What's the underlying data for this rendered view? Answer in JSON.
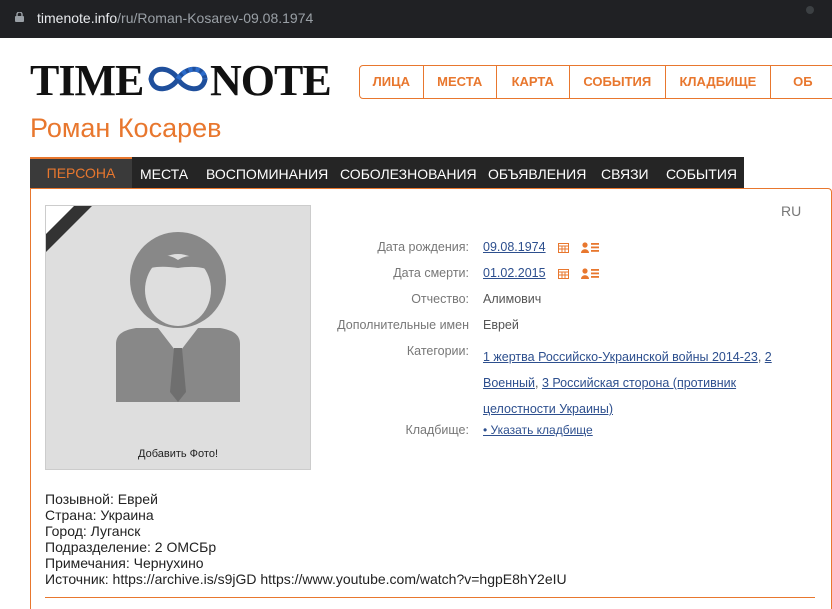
{
  "browser": {
    "url_host": "timenote.info",
    "url_path": "/ru/Roman-Kosarev-09.08.1974"
  },
  "logo": {
    "word1": "TIME",
    "word2": "NOTE"
  },
  "top_nav": [
    {
      "label": "ЛИЦА"
    },
    {
      "label": "МЕСТА"
    },
    {
      "label": "КАРТА"
    },
    {
      "label": "СОБЫТИЯ"
    },
    {
      "label": "КЛАДБИЩЕ"
    },
    {
      "label": "ОБ"
    }
  ],
  "person": {
    "name": "Роман Косарев"
  },
  "tabs": [
    {
      "label": "ПЕРСОНА"
    },
    {
      "label": "МЕСТА"
    },
    {
      "label": "ВОСПОМИНАНИЯ"
    },
    {
      "label": "СОБОЛЕЗНОВАНИЯ"
    },
    {
      "label": "ОБЪЯВЛЕНИЯ"
    },
    {
      "label": "СВЯЗИ"
    },
    {
      "label": "СОБЫТИЯ"
    }
  ],
  "lang": "RU",
  "photo": {
    "add_label": "Добавить Фото!"
  },
  "details": {
    "birth_label": "Дата рождения:",
    "birth_value": "09.08.1974",
    "death_label": "Дата смерти:",
    "death_value": "01.02.2015",
    "patronymic_label": "Отчество:",
    "patronymic_value": "Алимович",
    "extra_names_label": "Дополнительные имен",
    "extra_names_value": "Еврей",
    "categories_label": "Категории:",
    "categories": [
      {
        "label": "1 жертва Российско-Украинской войны 2014-23"
      },
      {
        "label": "2 Военный"
      },
      {
        "label": "3 Российская сторона (противник целостности Украины)"
      }
    ],
    "cemetery_label": "Кладбище:",
    "cemetery_link": "• Указать кладбище"
  },
  "extra_info": {
    "callsign": "Позывной: Еврей",
    "country": "Страна: Украина",
    "city": "Город: Луганск",
    "unit": "Подразделение: 2 ОМСБр",
    "notes": "Примечания: Чернухино",
    "source": "Источник: https://archive.is/s9jGD https://www.youtube.com/watch?v=hgpE8hY2eIU"
  },
  "colors": {
    "accent": "#e8772e",
    "link": "#2d4f8e",
    "tab_bar": "#252525"
  }
}
